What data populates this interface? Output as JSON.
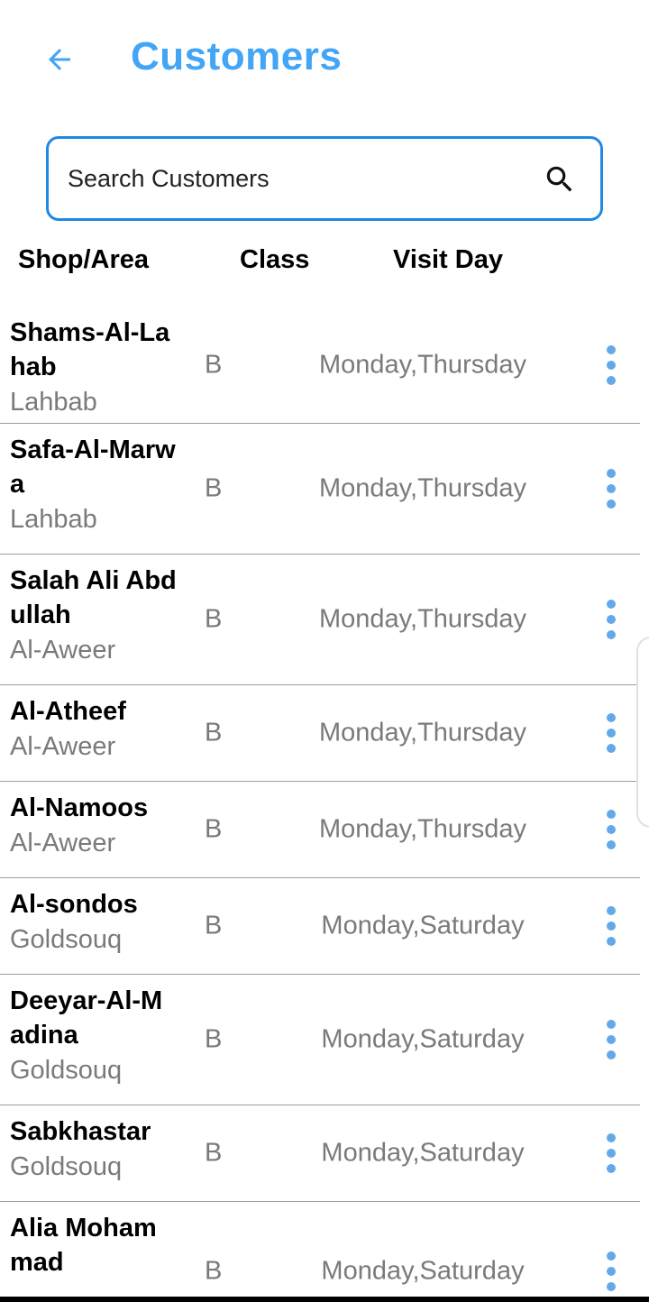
{
  "header": {
    "title": "Customers"
  },
  "search": {
    "placeholder": "Search Customers"
  },
  "columns": {
    "shop_area": "Shop/Area",
    "class": "Class",
    "visit_day": "Visit Day"
  },
  "customers": [
    {
      "name": "Shams-Al-Lahab",
      "area": "Lahbab",
      "class": "B",
      "visit_day": "Monday,Thursday"
    },
    {
      "name": "Safa-Al-Marwa",
      "area": "Lahbab",
      "class": "B",
      "visit_day": "Monday,Thursday"
    },
    {
      "name": "Salah Ali Abdullah",
      "area": "Al-Aweer",
      "class": "B",
      "visit_day": "Monday,Thursday"
    },
    {
      "name": "Al-Atheef",
      "area": "Al-Aweer",
      "class": "B",
      "visit_day": "Monday,Thursday"
    },
    {
      "name": "Al-Namoos",
      "area": "Al-Aweer",
      "class": "B",
      "visit_day": "Monday,Thursday"
    },
    {
      "name": "Al-sondos",
      "area": "Goldsouq",
      "class": "B",
      "visit_day": "Monday,Saturday"
    },
    {
      "name": "Deeyar-Al-Madina",
      "area": "Goldsouq",
      "class": "B",
      "visit_day": "Monday,Saturday"
    },
    {
      "name": "Sabkhastar",
      "area": "Goldsouq",
      "class": "B",
      "visit_day": "Monday,Saturday"
    },
    {
      "name": "Alia Mohammad",
      "area": "",
      "class": "B",
      "visit_day": "Monday,Saturday"
    }
  ],
  "icons": {
    "back": "arrow-left-icon",
    "search": "search-icon",
    "more": "more-vert-icon"
  },
  "colors": {
    "accent": "#42A5F5",
    "search_border": "#1E88E5",
    "secondary_text": "#7a7a7a",
    "dots": "#64A8E8"
  }
}
